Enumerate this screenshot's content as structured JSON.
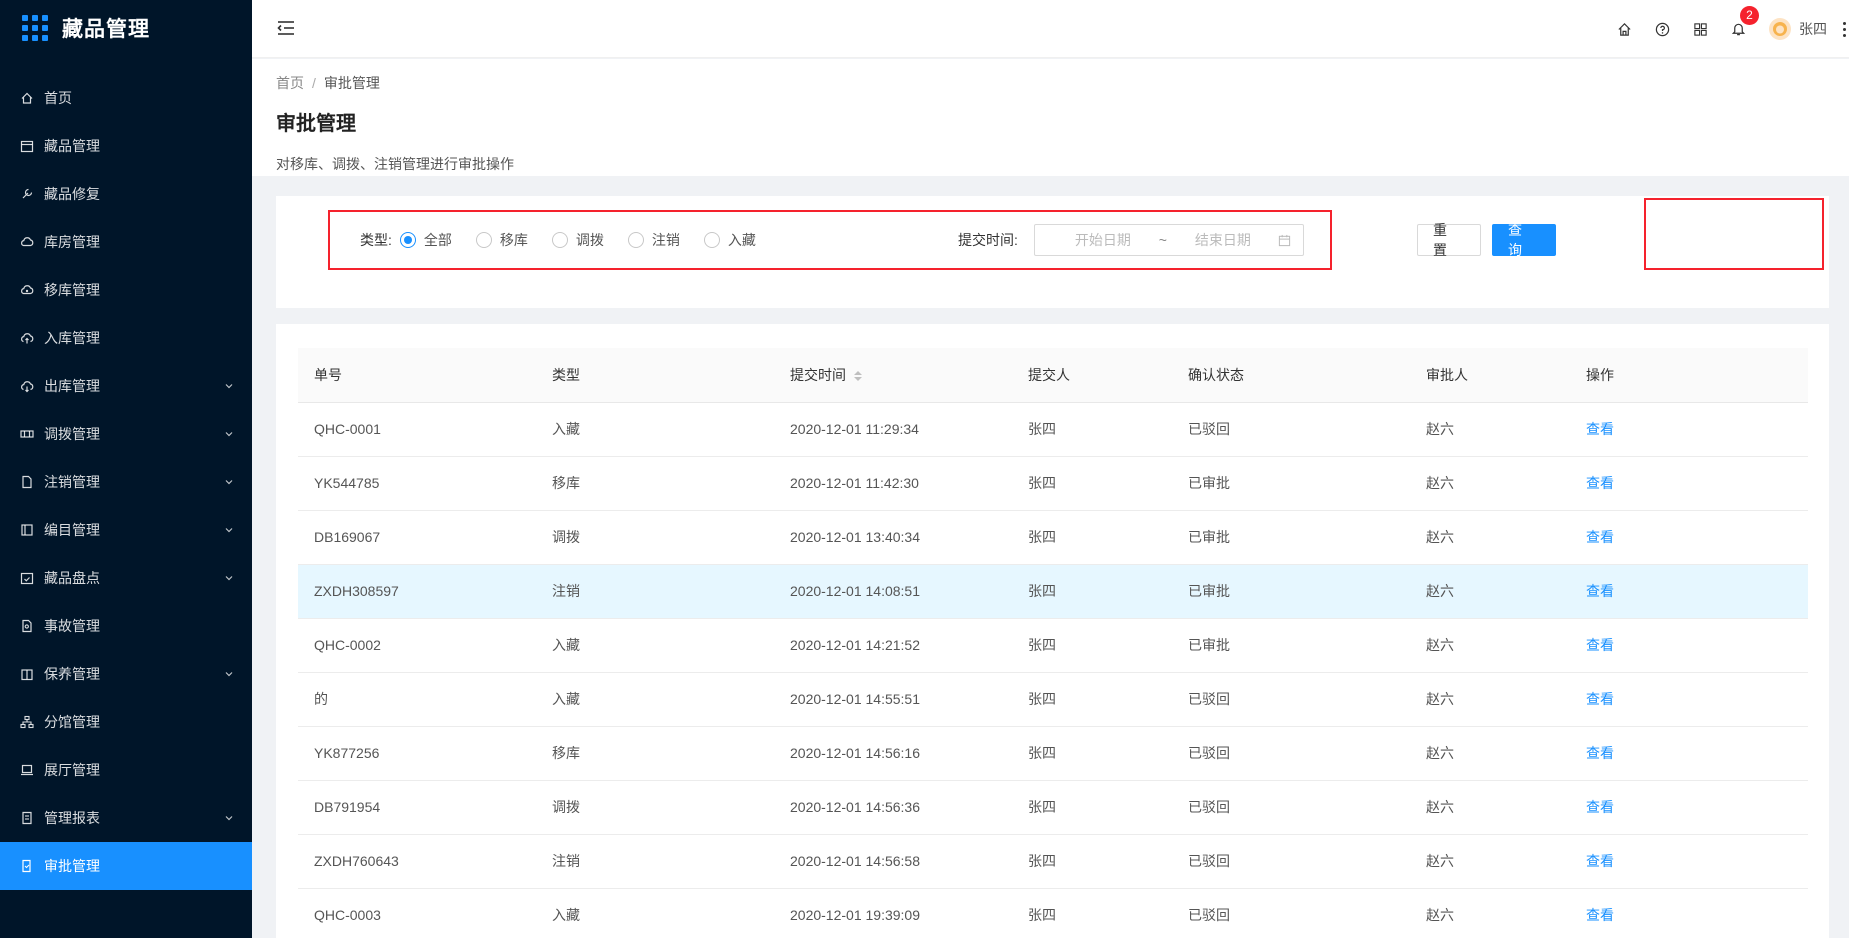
{
  "app": {
    "title": "藏品管理"
  },
  "sidebar": {
    "items": [
      {
        "label": "首页",
        "icon": "home-icon",
        "has_children": false,
        "active": false
      },
      {
        "label": "藏品管理",
        "icon": "calendar-icon",
        "has_children": false,
        "active": false
      },
      {
        "label": "藏品修复",
        "icon": "wrench-icon",
        "has_children": false,
        "active": false
      },
      {
        "label": "库房管理",
        "icon": "cloud-icon",
        "has_children": false,
        "active": false
      },
      {
        "label": "移库管理",
        "icon": "cloud-sync-icon",
        "has_children": false,
        "active": false
      },
      {
        "label": "入库管理",
        "icon": "cloud-upload-icon",
        "has_children": false,
        "active": false
      },
      {
        "label": "出库管理",
        "icon": "cloud-download-icon",
        "has_children": true,
        "active": false
      },
      {
        "label": "调拨管理",
        "icon": "transfer-icon",
        "has_children": true,
        "active": false
      },
      {
        "label": "注销管理",
        "icon": "file-icon",
        "has_children": true,
        "active": false
      },
      {
        "label": "编目管理",
        "icon": "catalog-icon",
        "has_children": true,
        "active": false
      },
      {
        "label": "藏品盘点",
        "icon": "calendar-check-icon",
        "has_children": true,
        "active": false
      },
      {
        "label": "事故管理",
        "icon": "file-search-icon",
        "has_children": false,
        "active": false
      },
      {
        "label": "保养管理",
        "icon": "building-icon",
        "has_children": true,
        "active": false
      },
      {
        "label": "分馆管理",
        "icon": "cluster-icon",
        "has_children": false,
        "active": false
      },
      {
        "label": "展厅管理",
        "icon": "laptop-icon",
        "has_children": false,
        "active": false
      },
      {
        "label": "管理报表",
        "icon": "report-icon",
        "has_children": true,
        "active": false
      },
      {
        "label": "审批管理",
        "icon": "audit-icon",
        "has_children": false,
        "active": true
      }
    ]
  },
  "header": {
    "notification_count": "2",
    "user_name": "张四",
    "icons": [
      "home-icon",
      "question-icon",
      "apps-icon",
      "bell-icon"
    ]
  },
  "page": {
    "breadcrumb": [
      "首页",
      "/",
      "审批管理"
    ],
    "title": "审批管理",
    "description": "对移库、调拨、注销管理进行审批操作"
  },
  "filter": {
    "type_label": "类型:",
    "options": [
      "全部",
      "移库",
      "调拨",
      "注销",
      "入藏"
    ],
    "selected_index": 0,
    "time_label": "提交时间:",
    "start_placeholder": "开始日期",
    "range_sep": "~",
    "end_placeholder": "结束日期",
    "reset_label": "重置",
    "query_label": "查询"
  },
  "colors": {
    "sidebar_bg": "#001529",
    "accent": "#1890ff",
    "highlight_box": "#f5222d",
    "row_highlight": "#e6f7ff"
  },
  "table": {
    "columns": [
      "单号",
      "类型",
      "提交时间",
      "提交人",
      "确认状态",
      "审批人",
      "操作"
    ],
    "rows": [
      {
        "id": "QHC-0001",
        "type": "入藏",
        "time": "2020-12-01 11:29:34",
        "submitter": "张四",
        "status": "已驳回",
        "approver": "赵六",
        "action": "查看"
      },
      {
        "id": "YK544785",
        "type": "移库",
        "time": "2020-12-01 11:42:30",
        "submitter": "张四",
        "status": "已审批",
        "approver": "赵六",
        "action": "查看"
      },
      {
        "id": "DB169067",
        "type": "调拨",
        "time": "2020-12-01 13:40:34",
        "submitter": "张四",
        "status": "已审批",
        "approver": "赵六",
        "action": "查看"
      },
      {
        "id": "ZXDH308597",
        "type": "注销",
        "time": "2020-12-01 14:08:51",
        "submitter": "张四",
        "status": "已审批",
        "approver": "赵六",
        "action": "查看"
      },
      {
        "id": "QHC-0002",
        "type": "入藏",
        "time": "2020-12-01 14:21:52",
        "submitter": "张四",
        "status": "已审批",
        "approver": "赵六",
        "action": "查看"
      },
      {
        "id": "的",
        "type": "入藏",
        "time": "2020-12-01 14:55:51",
        "submitter": "张四",
        "status": "已驳回",
        "approver": "赵六",
        "action": "查看"
      },
      {
        "id": "YK877256",
        "type": "移库",
        "time": "2020-12-01 14:56:16",
        "submitter": "张四",
        "status": "已驳回",
        "approver": "赵六",
        "action": "查看"
      },
      {
        "id": "DB791954",
        "type": "调拨",
        "time": "2020-12-01 14:56:36",
        "submitter": "张四",
        "status": "已驳回",
        "approver": "赵六",
        "action": "查看"
      },
      {
        "id": "ZXDH760643",
        "type": "注销",
        "time": "2020-12-01 14:56:58",
        "submitter": "张四",
        "status": "已驳回",
        "approver": "赵六",
        "action": "查看"
      },
      {
        "id": "QHC-0003",
        "type": "入藏",
        "time": "2020-12-01 19:39:09",
        "submitter": "张四",
        "status": "已驳回",
        "approver": "赵六",
        "action": "查看"
      }
    ],
    "highlighted_row": 3
  }
}
